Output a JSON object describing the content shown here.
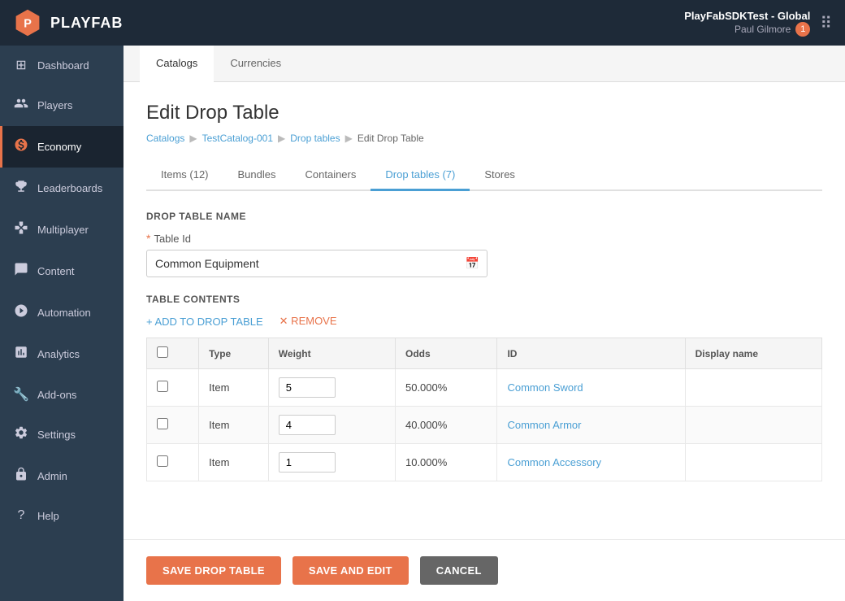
{
  "app": {
    "name": "PLAYFAB"
  },
  "header": {
    "title": "PlayFabSDKTest - Global",
    "user": "Paul Gilmore",
    "notification_count": "1"
  },
  "sidebar": {
    "items": [
      {
        "id": "dashboard",
        "label": "Dashboard",
        "icon": "⊞"
      },
      {
        "id": "players",
        "label": "Players",
        "icon": "👥"
      },
      {
        "id": "economy",
        "label": "Economy",
        "icon": "$",
        "active": true
      },
      {
        "id": "leaderboards",
        "label": "Leaderboards",
        "icon": "🏆"
      },
      {
        "id": "multiplayer",
        "label": "Multiplayer",
        "icon": "🎮"
      },
      {
        "id": "content",
        "label": "Content",
        "icon": "📢"
      },
      {
        "id": "automation",
        "label": "Automation",
        "icon": "⚙"
      },
      {
        "id": "analytics",
        "label": "Analytics",
        "icon": "📊"
      },
      {
        "id": "addons",
        "label": "Add-ons",
        "icon": "🔧"
      },
      {
        "id": "settings",
        "label": "Settings",
        "icon": "⚙"
      },
      {
        "id": "admin",
        "label": "Admin",
        "icon": "🔒"
      },
      {
        "id": "help",
        "label": "Help",
        "icon": "?"
      }
    ]
  },
  "top_tabs": [
    {
      "id": "catalogs",
      "label": "Catalogs",
      "active": true
    },
    {
      "id": "currencies",
      "label": "Currencies",
      "active": false
    }
  ],
  "page": {
    "title": "Edit Drop Table",
    "breadcrumb": {
      "items": [
        {
          "id": "catalogs",
          "label": "Catalogs",
          "link": true
        },
        {
          "id": "testcatalog",
          "label": "TestCatalog-001",
          "link": true
        },
        {
          "id": "droptables",
          "label": "Drop tables",
          "link": true
        },
        {
          "id": "edit",
          "label": "Edit Drop Table",
          "link": false
        }
      ]
    }
  },
  "inner_tabs": [
    {
      "id": "items",
      "label": "Items (12)",
      "active": false
    },
    {
      "id": "bundles",
      "label": "Bundles",
      "active": false
    },
    {
      "id": "containers",
      "label": "Containers",
      "active": false
    },
    {
      "id": "droptables",
      "label": "Drop tables (7)",
      "active": true
    },
    {
      "id": "stores",
      "label": "Stores",
      "active": false
    }
  ],
  "form": {
    "section_drop_table_name": "DROP TABLE NAME",
    "field_table_id_label": "Table Id",
    "field_table_id_value": "Common Equipment",
    "section_table_contents": "TABLE CONTENTS",
    "add_label": "+ ADD TO DROP TABLE",
    "remove_label": "✕ REMOVE"
  },
  "table": {
    "columns": [
      "",
      "Type",
      "Weight",
      "Odds",
      "ID",
      "Display name"
    ],
    "rows": [
      {
        "type": "Item",
        "weight": "5",
        "odds": "50.000%",
        "id": "Common Sword",
        "display_name": ""
      },
      {
        "type": "Item",
        "weight": "4",
        "odds": "40.000%",
        "id": "Common Armor",
        "display_name": ""
      },
      {
        "type": "Item",
        "weight": "1",
        "odds": "10.000%",
        "id": "Common Accessory",
        "display_name": ""
      }
    ]
  },
  "actions": {
    "save_drop_table": "SAVE DROP TABLE",
    "save_and_edit": "SAVE AND EDIT",
    "cancel": "CANCEL"
  }
}
